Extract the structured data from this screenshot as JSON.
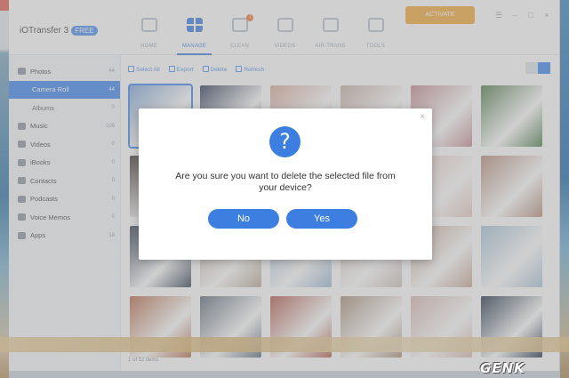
{
  "app": {
    "name": "iOTransfer 3",
    "version_badge": "FREE",
    "activate_label": "ACTIVATE",
    "window_controls": [
      "menu-icon",
      "minimize-icon",
      "maximize-icon",
      "close-icon"
    ]
  },
  "nav_tabs": [
    {
      "label": "HOME",
      "icon": "home-icon",
      "active": false
    },
    {
      "label": "MANAGE",
      "icon": "grid-icon",
      "active": true
    },
    {
      "label": "CLEAN",
      "icon": "broom-icon",
      "active": false,
      "badge": "!"
    },
    {
      "label": "VIDEOS",
      "icon": "video-icon",
      "active": false
    },
    {
      "label": "AIR-TRANS",
      "icon": "wifi-icon",
      "active": false
    },
    {
      "label": "TOOLS",
      "icon": "toolbox-icon",
      "active": false
    }
  ],
  "sidebar": {
    "items": [
      {
        "label": "Photos",
        "count": "44",
        "icon": "photo-icon"
      },
      {
        "label": "Camera Roll",
        "count": "44",
        "sub": true,
        "selected": true
      },
      {
        "label": "Albums",
        "count": "0",
        "sub": true
      },
      {
        "label": "Music",
        "count": "109",
        "icon": "music-icon"
      },
      {
        "label": "Videos",
        "count": "0",
        "icon": "video-icon"
      },
      {
        "label": "iBooks",
        "count": "0",
        "icon": "book-icon"
      },
      {
        "label": "Contacts",
        "count": "0",
        "icon": "contacts-icon"
      },
      {
        "label": "Podcasts",
        "count": "0",
        "icon": "podcast-icon"
      },
      {
        "label": "Voice Memos",
        "count": "0",
        "icon": "mic-icon"
      },
      {
        "label": "Apps",
        "count": "18",
        "icon": "apps-icon"
      }
    ]
  },
  "toolbar": {
    "select_all": "Select All",
    "export": "Export",
    "delete": "Delete",
    "refresh": "Refresh"
  },
  "status": {
    "text": "1 of 52 items"
  },
  "dialog": {
    "icon": "question-icon",
    "close_glyph": "×",
    "message_line1": "Are you sure you want to delete the selected file from",
    "message_line2": "your device?",
    "no_label": "No",
    "yes_label": "Yes"
  },
  "colors": {
    "accent": "#3d7fe0",
    "activate": "#f2a93b",
    "overlay": "rgba(150,150,150,0.45)"
  },
  "watermark": "GENK"
}
